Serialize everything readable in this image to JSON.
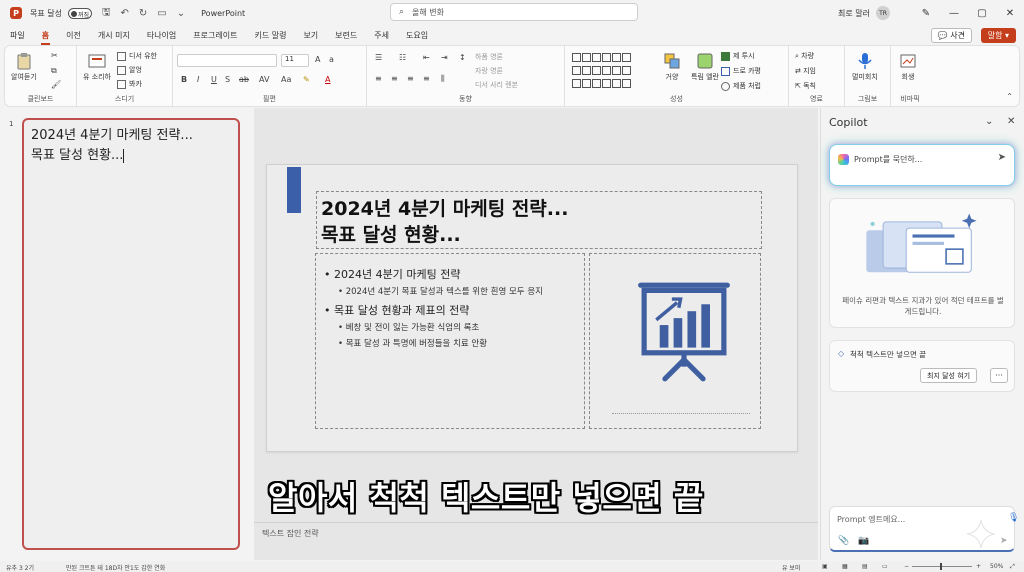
{
  "titlebar": {
    "autosave_label": "목표 달성",
    "toggle_state": "꺼짐",
    "doc_name": "PowerPoint",
    "search_placeholder": "올해 변화",
    "user_name": "최로 말러",
    "user_initials": "TR"
  },
  "ribbon_tabs": [
    "파일",
    "홈",
    "이전",
    "개시 미지",
    "타나이엄",
    "프로그레이트",
    "키드 말령",
    "보기",
    "보련드",
    "주세",
    "도요임"
  ],
  "active_tab_index": 1,
  "header_buttons": {
    "comment": "사견",
    "share": "말함"
  },
  "ribbon": {
    "clipboard": {
      "paste": "알여듣기",
      "label": "클린보드"
    },
    "slides": {
      "new_slide": "유 소리하",
      "layout": "디서 유한",
      "reset": "알엉",
      "section": "봐카",
      "label": "스디기"
    },
    "font": {
      "label": "필편",
      "size": "11"
    },
    "paragraph": {
      "label": "동향",
      "dir": "하폼 영론",
      "align": "자랑 영론",
      "smart": "디서 사리 렌본"
    },
    "drawing": {
      "arrange": "거양",
      "quick": "특림 엘란",
      "fill": "제 투시",
      "outline": "드로 카평",
      "effect": "제품 처럽",
      "label": "성성"
    },
    "editing": {
      "find": "차량",
      "replace": "지임",
      "select": "독칙",
      "label": "영료"
    },
    "voice": {
      "dictate": "멀미회치",
      "label": "그림보"
    },
    "designer": {
      "btn": "회생",
      "label": "비마픽"
    }
  },
  "thumbnail": {
    "number": "1",
    "text": "2024년 4분기 마케팅 전략...\n목표 달성 현황..."
  },
  "slide": {
    "title": "2024년 4분기 마케팅 전략...\n목표 달성 현황...",
    "bullets": [
      {
        "level": 1,
        "text": "2024년 4분기 마케팅 전략"
      },
      {
        "level": 2,
        "text": "2024년 4분기 목표 달성과 텍스를 위한 흰영 모두 응지"
      },
      {
        "level": 1,
        "text": "목표 달성 현황과 제표의 전략"
      },
      {
        "level": 2,
        "text": "베창 및 전이 잃는 가능환 식엄의 록초"
      },
      {
        "level": 2,
        "text": "목표 달성 과 특명에 버정들을 치료 안황"
      }
    ]
  },
  "notes_text": "텍스트 잡인 전략",
  "video_subtitle": "알아서 척척 텍스트만 넣으면 끝",
  "copilot": {
    "title": "Copilot",
    "prompt_placeholder": "Prompt를 묵던하...",
    "card_desc": "페이슈 리편과 텍스트 지과가 있어 적던 테프트를 벌게드립니다.",
    "suggestion": "척척 텍스트만 넣으면 끝",
    "suggestion_btn": "최지 달성 혀기",
    "more": "···",
    "input_placeholder": "Prompt 엥트메요..."
  },
  "statusbar": {
    "slide_info": "유추 3 2기",
    "lang": "만된 크트튼 테 18D차 안1도 갑한 연화",
    "notes": "유 보미",
    "zoom": "50%"
  },
  "colors": {
    "accent": "#c43e1c",
    "slide_accent": "#3b5fa8",
    "selection": "#c0504d"
  }
}
